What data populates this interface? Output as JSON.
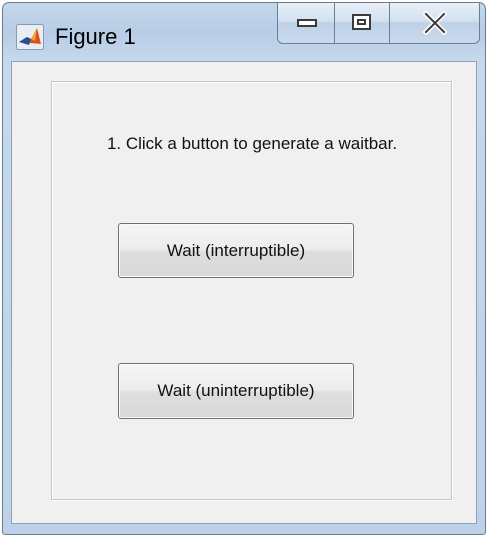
{
  "window": {
    "title": "Figure 1",
    "icon": "matlab-icon",
    "caption_buttons": [
      "minimize-icon",
      "maximize-icon",
      "close-icon"
    ]
  },
  "panel": {
    "instruction": "1. Click a button to generate a waitbar."
  },
  "buttons": {
    "interruptible_label": "Wait (interruptible)",
    "uninterruptible_label": "Wait (uninterruptible)"
  },
  "colors": {
    "title_bar": "#b7cde5",
    "client_background": "#f0f0f0",
    "button_border": "#707070"
  }
}
